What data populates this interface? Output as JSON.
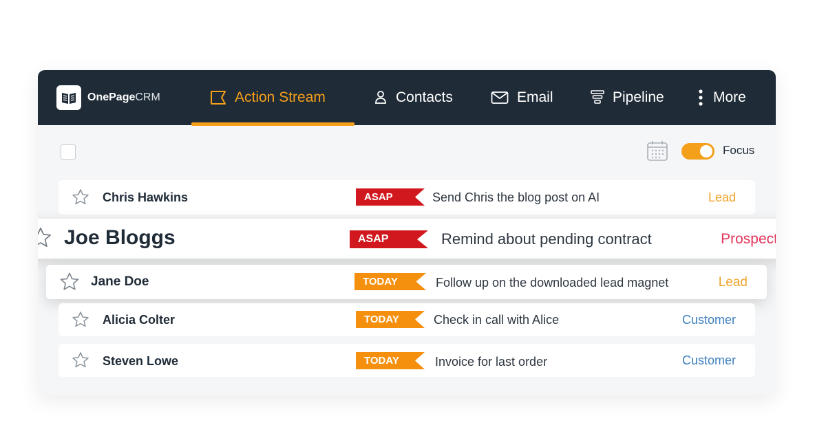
{
  "brand": {
    "bold": "OnePage",
    "light": "CRM"
  },
  "nav": {
    "action_stream": "Action Stream",
    "contacts": "Contacts",
    "email": "Email",
    "pipeline": "Pipeline",
    "more": "More"
  },
  "toolbar": {
    "focus_label": "Focus",
    "focus_on": true
  },
  "colors": {
    "accent": "#f5a01a",
    "header_bg": "#1f2b37",
    "asap": "#d0181e",
    "today": "#f5900f",
    "lead": "#f0a32a",
    "prospect": "#e0345a",
    "customer": "#3d7fbf"
  },
  "rows": [
    {
      "name": "Chris Hawkins",
      "tag": "ASAP",
      "task": "Send Chris the blog post on AI",
      "status": "Lead"
    },
    {
      "name": "Joe Bloggs",
      "tag": "ASAP",
      "task": "Remind about pending contract",
      "status": "Prospect"
    },
    {
      "name": "Jane Doe",
      "tag": "TODAY",
      "task": "Follow up on the downloaded lead magnet",
      "status": "Lead"
    },
    {
      "name": "Alicia Colter",
      "tag": "TODAY",
      "task": "Check in call with Alice",
      "status": "Customer"
    },
    {
      "name": "Steven Lowe",
      "tag": "TODAY",
      "task": "Invoice for last order",
      "status": "Customer"
    }
  ]
}
